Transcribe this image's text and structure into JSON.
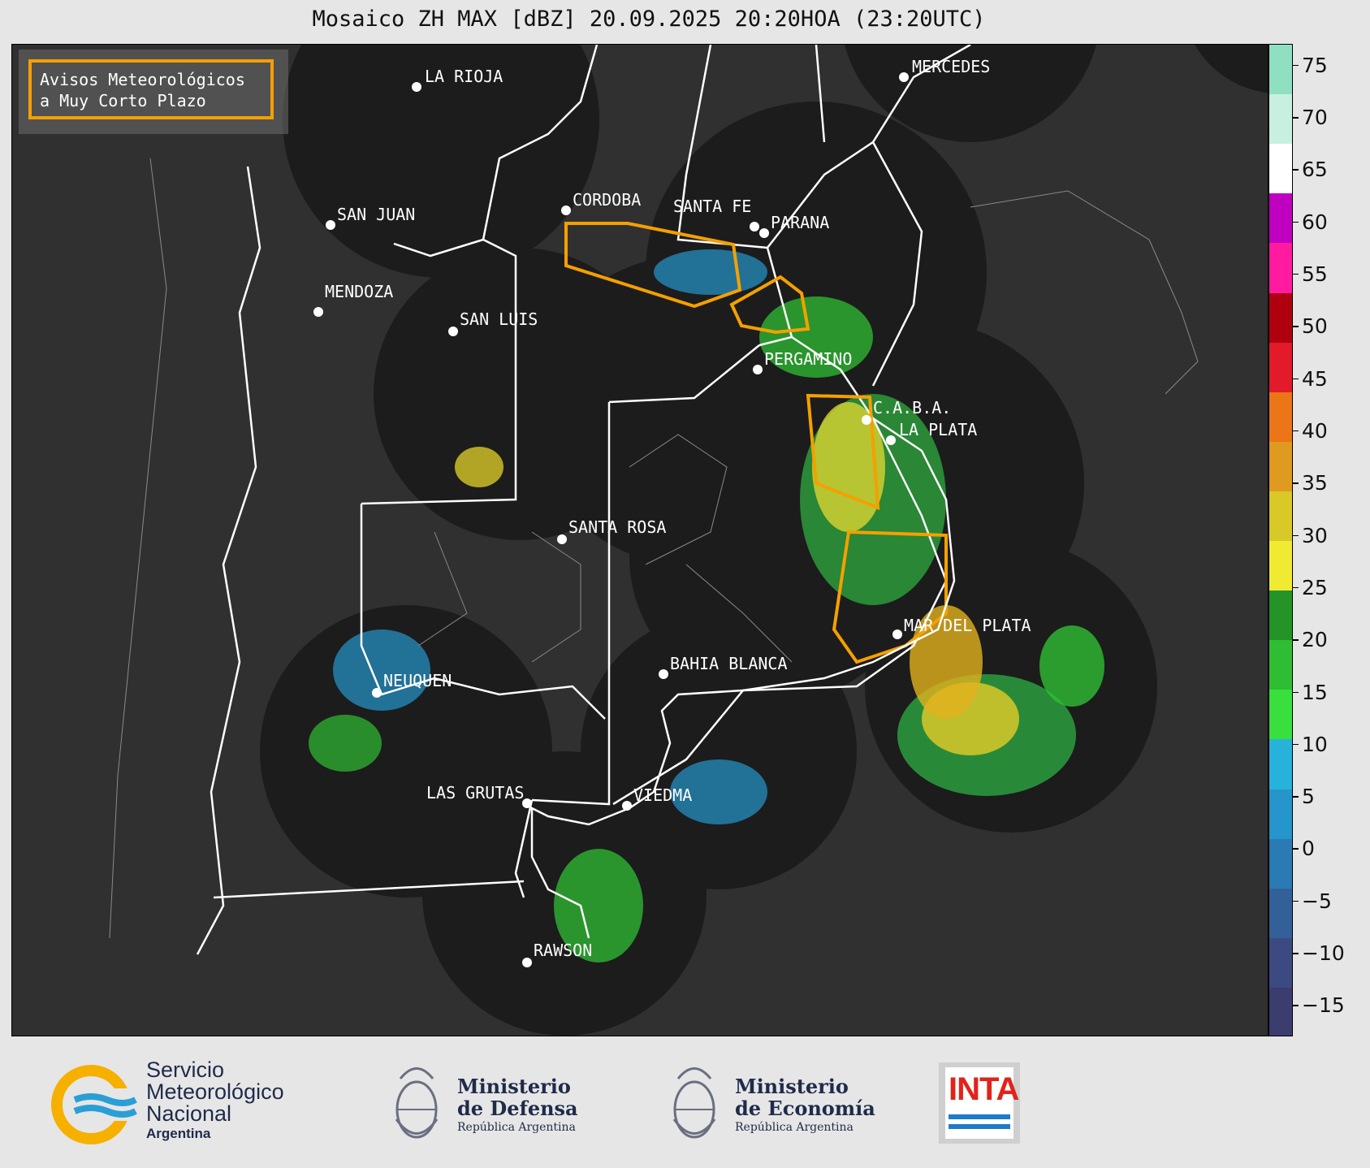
{
  "title": "Mosaico ZH MAX [dBZ] 20.09.2025 20:20HOA (23:20UTC)",
  "legend": {
    "line1": "Avisos Meteorológicos",
    "line2": "a Muy Corto Plazo",
    "color": "#f5a000"
  },
  "colorbar": {
    "unit": "dBZ",
    "ticks": [
      "75",
      "70",
      "65",
      "60",
      "55",
      "50",
      "45",
      "40",
      "35",
      "30",
      "25",
      "20",
      "15",
      "10",
      "5",
      "0",
      "−5",
      "−10",
      "−15"
    ],
    "range": [
      -18,
      77
    ],
    "colors_low_to_high": [
      "#3b3d6e",
      "#3c4a82",
      "#34609a",
      "#2a7ab4",
      "#2596cc",
      "#27b2dc",
      "#39e03d",
      "#2fbd33",
      "#249428",
      "#f0eb32",
      "#d8c828",
      "#e09a20",
      "#ec7518",
      "#e21a2a",
      "#b00010",
      "#ff1aa0",
      "#c000c0",
      "#ffffff",
      "#c8f0e0",
      "#8ee0c0"
    ]
  },
  "cities": [
    {
      "name": "LA RIOJA"
    },
    {
      "name": "MERCEDES"
    },
    {
      "name": "SAN JUAN"
    },
    {
      "name": "CORDOBA"
    },
    {
      "name": "SANTA FE"
    },
    {
      "name": "PARANA"
    },
    {
      "name": "MENDOZA"
    },
    {
      "name": "SAN LUIS"
    },
    {
      "name": "PERGAMINO"
    },
    {
      "name": "C.A.B.A."
    },
    {
      "name": "LA PLATA"
    },
    {
      "name": "SANTA ROSA"
    },
    {
      "name": "MAR DEL PLATA"
    },
    {
      "name": "NEUQUEN"
    },
    {
      "name": "BAHIA BLANCA"
    },
    {
      "name": "LAS GRUTAS"
    },
    {
      "name": "VIEDMA"
    },
    {
      "name": "RAWSON"
    }
  ],
  "footer": {
    "smn_line1": "Servicio",
    "smn_line2": "Meteorológico",
    "smn_line3": "Nacional",
    "smn_country": "Argentina",
    "defensa_line1": "Ministerio",
    "defensa_line2": "de Defensa",
    "defensa_sub": "República Argentina",
    "economia_line1": "Ministerio",
    "economia_line2": "de Economía",
    "economia_sub": "República Argentina",
    "inta": "INTA"
  }
}
